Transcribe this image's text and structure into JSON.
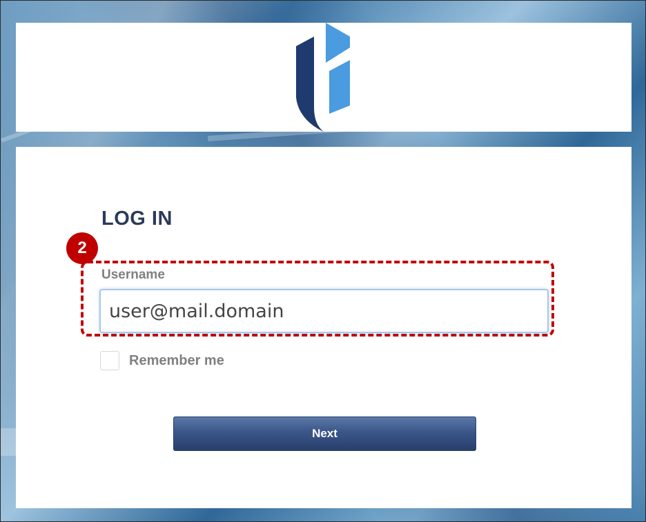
{
  "page": {
    "title": "LOG IN",
    "step_badge": "2"
  },
  "form": {
    "username_label": "Username",
    "username_value": "user@mail.domain",
    "remember_label": "Remember me",
    "remember_checked": false,
    "next_label": "Next"
  },
  "colors": {
    "title": "#2c3a5a",
    "callout": "#c00000",
    "button": "#3b5689",
    "logo_dark": "#1f3a6e",
    "logo_light": "#4a9be0"
  },
  "icons": {
    "logo": "brand-logo"
  }
}
